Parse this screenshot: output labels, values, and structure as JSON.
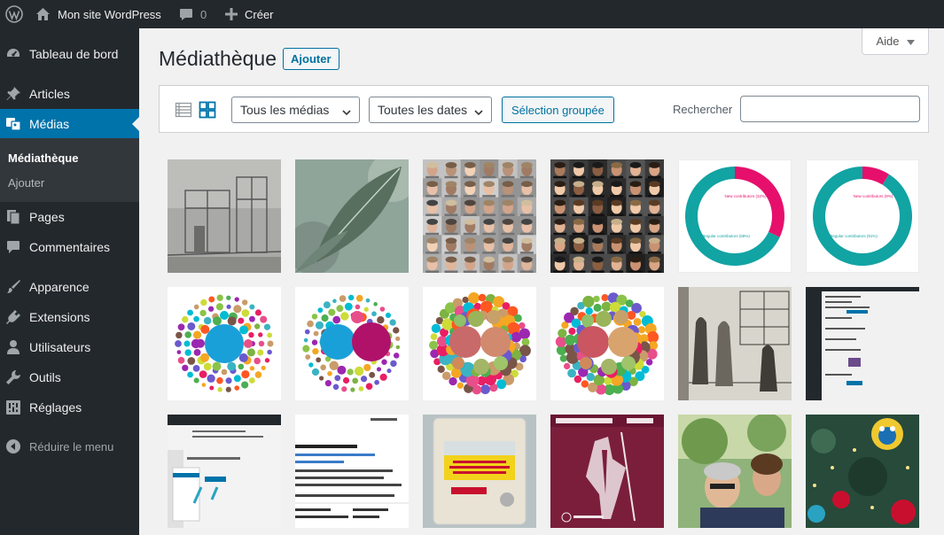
{
  "adminbar": {
    "site_name": "Mon site WordPress",
    "comments_count": "0",
    "new_label": "Créer"
  },
  "sidebar": {
    "items": [
      {
        "label": "Tableau de bord",
        "icon": "dashboard-icon"
      },
      {
        "label": "Articles",
        "icon": "pushpin-icon"
      },
      {
        "label": "Médias",
        "icon": "media-icon"
      },
      {
        "label": "Pages",
        "icon": "pages-icon"
      },
      {
        "label": "Commentaires",
        "icon": "comments-icon"
      },
      {
        "label": "Apparence",
        "icon": "brush-icon"
      },
      {
        "label": "Extensions",
        "icon": "plugin-icon"
      },
      {
        "label": "Utilisateurs",
        "icon": "users-icon"
      },
      {
        "label": "Outils",
        "icon": "wrench-icon"
      },
      {
        "label": "Réglages",
        "icon": "settings-icon"
      }
    ],
    "submenu": [
      {
        "label": "Médiathèque"
      },
      {
        "label": "Ajouter"
      }
    ],
    "collapse_label": "Réduire le menu",
    "accent": "#0073aa"
  },
  "main": {
    "title": "Médiathèque",
    "add_button": "Ajouter",
    "help_label": "Aide",
    "filters": {
      "media_type": "Tous les médias",
      "dates": "Toutes les dates"
    },
    "bulk_select": "Sélection groupée",
    "search_label": "Rechercher",
    "search_value": ""
  },
  "media": [
    {
      "kind": "vintage-photo"
    },
    {
      "kind": "leaf-photo"
    },
    {
      "kind": "portrait-collage-light"
    },
    {
      "kind": "portrait-collage-dark"
    },
    {
      "kind": "donut-chart",
      "labels": [
        "New contributors (32%)",
        "Regular contributors (68%)"
      ],
      "values": [
        32,
        68
      ]
    },
    {
      "kind": "donut-chart",
      "labels": [
        "New contributors (9%)",
        "Regular contributors (91%)"
      ],
      "values": [
        9,
        91
      ]
    },
    {
      "kind": "bubble-chart"
    },
    {
      "kind": "bubble-chart"
    },
    {
      "kind": "bubble-chart"
    },
    {
      "kind": "bubble-chart"
    },
    {
      "kind": "engraving"
    },
    {
      "kind": "admin-screenshot"
    },
    {
      "kind": "admin-screenshot-light"
    },
    {
      "kind": "text-document"
    },
    {
      "kind": "emergency-call-box"
    },
    {
      "kind": "wordpress-release-poster"
    },
    {
      "kind": "selfie-photo"
    },
    {
      "kind": "christmas-tree-photo"
    }
  ]
}
